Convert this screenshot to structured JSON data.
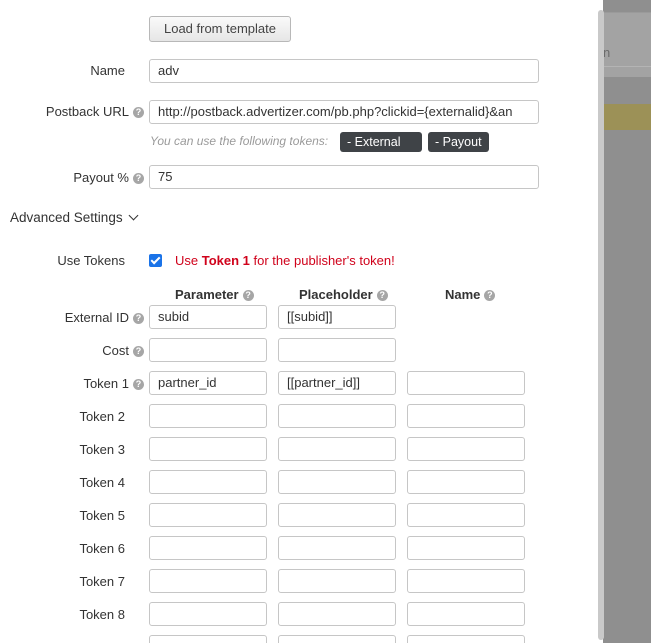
{
  "form": {
    "load_template_label": "Load from template",
    "name_label": "Name",
    "name_value": "adv",
    "postback_label": "Postback URL",
    "postback_value": "http://postback.advertizer.com/pb.php?clickid={externalid}&an",
    "tokens_hint": "You can use the following tokens:",
    "token_external_id": "- External ID",
    "token_payout": "- Payout",
    "payout_label": "Payout %",
    "payout_value": "75",
    "advanced_label": "Advanced Settings",
    "use_tokens_label": "Use Tokens",
    "use_tokens_checked": true,
    "warning_prefix": "Use ",
    "warning_bold": "Token 1",
    "warning_suffix": " for the publisher's token!",
    "help_glyph": "?"
  },
  "table": {
    "headers": {
      "parameter": "Parameter",
      "placeholder": "Placeholder",
      "name": "Name"
    },
    "rows": [
      {
        "label": "External ID",
        "parameter": "subid",
        "placeholder": "[[subid]]",
        "name": null
      },
      {
        "label": "Cost",
        "parameter": "",
        "placeholder": "",
        "name": null
      },
      {
        "label": "Token 1",
        "parameter": "partner_id",
        "placeholder": "[[partner_id]]",
        "name": ""
      },
      {
        "label": "Token 2",
        "parameter": "",
        "placeholder": "",
        "name": ""
      },
      {
        "label": "Token 3",
        "parameter": "",
        "placeholder": "",
        "name": ""
      },
      {
        "label": "Token 4",
        "parameter": "",
        "placeholder": "",
        "name": ""
      },
      {
        "label": "Token 5",
        "parameter": "",
        "placeholder": "",
        "name": ""
      },
      {
        "label": "Token 6",
        "parameter": "",
        "placeholder": "",
        "name": ""
      },
      {
        "label": "Token 7",
        "parameter": "",
        "placeholder": "",
        "name": ""
      },
      {
        "label": "Token 8",
        "parameter": "",
        "placeholder": "",
        "name": ""
      },
      {
        "label": "",
        "parameter": "",
        "placeholder": "",
        "name": ""
      }
    ]
  },
  "background": {
    "fragment_text": "n"
  },
  "colors": {
    "checkbox": "#1a73e8",
    "warning": "#d0021b",
    "token_bg": "#3f4347"
  }
}
